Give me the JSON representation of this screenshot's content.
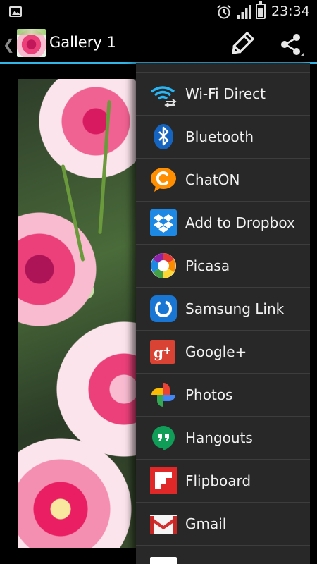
{
  "status_bar": {
    "time": "23:34",
    "icons": [
      "gallery-notification-icon",
      "alarm-icon",
      "signal-icon",
      "battery-icon"
    ]
  },
  "action_bar": {
    "title": "Gallery 1",
    "up_icon": "chevron-left-icon",
    "actions": [
      "edit-icon",
      "share-icon"
    ],
    "accent_color": "#33b5e5"
  },
  "share_menu": {
    "items": [
      {
        "label": "Wi-Fi Direct",
        "icon": "wifi-direct-icon"
      },
      {
        "label": "Bluetooth",
        "icon": "bluetooth-icon"
      },
      {
        "label": "ChatON",
        "icon": "chaton-icon"
      },
      {
        "label": "Add to Dropbox",
        "icon": "dropbox-icon"
      },
      {
        "label": "Picasa",
        "icon": "picasa-icon"
      },
      {
        "label": "Samsung Link",
        "icon": "samsung-link-icon"
      },
      {
        "label": "Google+",
        "icon": "google-plus-icon"
      },
      {
        "label": "Photos",
        "icon": "photos-icon"
      },
      {
        "label": "Hangouts",
        "icon": "hangouts-icon"
      },
      {
        "label": "Flipboard",
        "icon": "flipboard-icon"
      },
      {
        "label": "Gmail",
        "icon": "gmail-icon"
      }
    ]
  }
}
